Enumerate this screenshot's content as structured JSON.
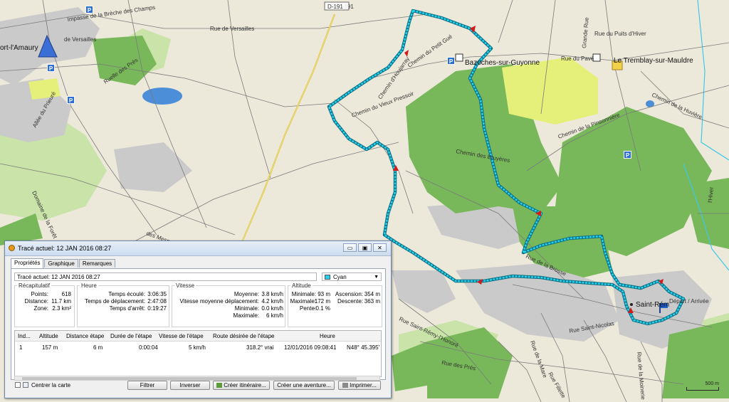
{
  "map": {
    "roads": {
      "d191": "D-191",
      "rue_versailles": "Rue de Versailles",
      "impasse": "Impasse de la Brèche des Champs",
      "rue_champs": "Rue des Champs",
      "ruelle_pres": "Ruelle des Prés",
      "allee_prieure": "Allée du Prieuré",
      "rue_versailles2": "de Versailles",
      "chemin_blaise": "Blaise",
      "chemin_vieux_pressoir": "Chemin du Vieux Pressoir",
      "chemin_petit_gue": "Chemin du Petit Gué",
      "chemin_houjarray": "Chemin d'Houjarray",
      "chemin_bruyeres": "Chemin des Bruyères",
      "chemin_pinsonniere": "Chemin de la Pinsonnière",
      "chemin_huviere": "Chemin de la Huvière",
      "rue_puits_hiver": "Rue du Puits d'Hiver",
      "rue_pave": "Rue du Pavé",
      "grande_rue": "Grande Rue",
      "rue_saint_nicolas": "Rue Saint-Nicolas",
      "rue_des_pres": "Rue des Prés",
      "rue_mare": "Rue de la Mare",
      "rue_brosse": "Rue de la Brosse",
      "rue_moinerie": "Rue de la Moinerie",
      "rue_saint_remy": "Rue Saint-Rémy-l'Honoré",
      "rue_fillette": "Rue Fillette",
      "mesnuls": "des Mesnuls",
      "domaine_forets": "Domaine de la Forêt",
      "rue_hiver": "l'Hiver"
    },
    "towns": {
      "montfort": "ort-l'Amaury",
      "bazoches": "Bazoches-sur-Guyonne",
      "tremblay": "Le Tremblay-sur-Mauldre",
      "saint_remy": "Saint-Rémy-l'Honoré",
      "saint_rem_label": "Saint-Rém",
      "depart": "Départ / Arrivée"
    },
    "poi_letter": "P",
    "scale": "500 m",
    "colors": {
      "track": "#22d3ee",
      "forest": "#78b85a",
      "light_green": "#c9e3a8",
      "urban": "#c8c8c8",
      "water": "#4c8ed8",
      "highlight": "#e5f07a"
    }
  },
  "dialog": {
    "title": "Tracé actuel: 12 JAN 2016 08:27",
    "window_buttons": [
      "▭",
      "▣",
      "✕"
    ],
    "tabs": [
      "Propriétés",
      "Graphique",
      "Remarques"
    ],
    "track_name": "Tracé actuel: 12 JAN 2016 08:27",
    "color": "Cyan",
    "recap": {
      "title": "Récapitulatif",
      "points_label": "Points:",
      "points": "618",
      "distance_label": "Distance:",
      "distance": "11.7 km",
      "zone_label": "Zone:",
      "zone": "2.3 km²"
    },
    "heure": {
      "title": "Heure",
      "elapsed_label": "Temps écoulé:",
      "elapsed": "3:06:35",
      "moving_label": "Temps de déplacement:",
      "moving": "2:47:08",
      "stopped_label": "Temps d'arrêt:",
      "stopped": "0:19:27"
    },
    "vitesse": {
      "title": "Vitesse",
      "avg_label": "Moyenne:",
      "avg": "3.8 km/h",
      "avg_moving_label": "Vitesse moyenne déplacement:",
      "avg_moving": "4.2 km/h",
      "min_label": "Minimale:",
      "min": "0.0 km/h",
      "max_label": "Maximale:",
      "max": "6 km/h"
    },
    "altitude": {
      "title": "Altitude",
      "min_label": "Minimale:",
      "min": "93 m",
      "max_label": "Maximale:",
      "max": "172 m",
      "slope_label": "Pente:",
      "slope": "-0.1 %",
      "ascent_label": "Ascension:",
      "ascent": "354 m",
      "descent_label": "Descente:",
      "descent": "363 m"
    },
    "table": {
      "columns": [
        "Ind...",
        "Altitude",
        "Distance étape",
        "Durée de l'étape",
        "Vitesse de l'étape",
        "Route désirée de l'étape",
        "Heure"
      ],
      "rows": [
        [
          "1",
          "157 m",
          "6 m",
          "0:00:04",
          "5 km/h",
          "318.2° vrai",
          "12/01/2016 09:08:41",
          "N48° 45.395'"
        ]
      ]
    },
    "center_map": "Centrer la carte",
    "buttons": {
      "filter": "Filtrer",
      "reverse": "Inverser",
      "create_route": "Créer itinéraire...",
      "create_adventure": "Créer une aventure...",
      "print": "Imprimer..."
    }
  }
}
